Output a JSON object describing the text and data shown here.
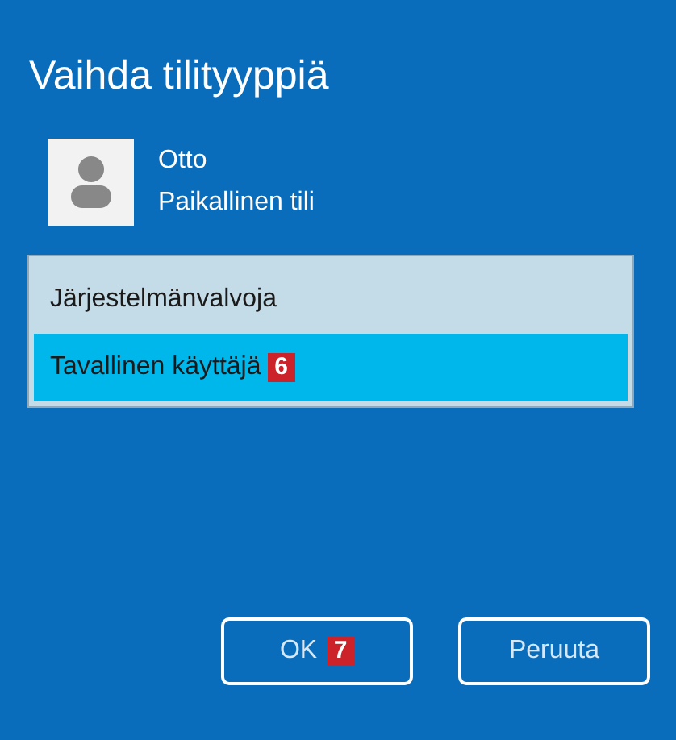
{
  "window": {
    "title": "Vaihda tilityyppiä"
  },
  "user": {
    "name": "Otto",
    "account": "Paikallinen tili"
  },
  "account_types": [
    {
      "label": "Järjestelmänvalvoja",
      "selected": false
    },
    {
      "label": "Tavallinen käyttäjä",
      "selected": true,
      "badge": "6"
    }
  ],
  "buttons": [
    {
      "label": "OK",
      "badge": "7"
    },
    {
      "label": "Peruuta"
    }
  ]
}
